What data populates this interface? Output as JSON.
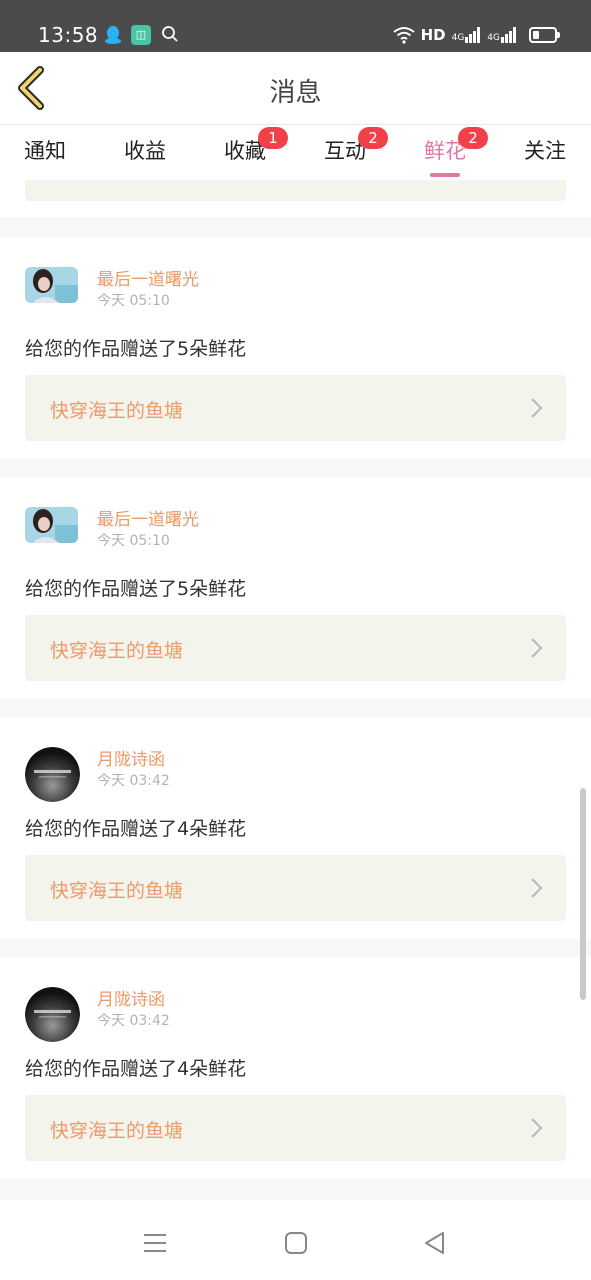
{
  "status_bar": {
    "time": "13:58",
    "icons": [
      "qq-icon",
      "app-icon",
      "search-icon",
      "wifi-icon",
      "hd-icon",
      "signal-4g-icon",
      "signal-4g-icon",
      "battery-icon"
    ],
    "hd": "HD",
    "net1": "4G",
    "net2": "4G"
  },
  "header": {
    "title": "消息"
  },
  "tabs": [
    {
      "label": "通知",
      "badge": "",
      "active": false
    },
    {
      "label": "收益",
      "badge": "",
      "active": false
    },
    {
      "label": "收藏",
      "badge": "1",
      "active": false
    },
    {
      "label": "互动",
      "badge": "2",
      "active": false
    },
    {
      "label": "鲜花",
      "badge": "2",
      "active": true
    },
    {
      "label": "关注",
      "badge": "",
      "active": false
    }
  ],
  "messages": [
    {
      "user": "最后一道曙光",
      "time": "今天 05:10",
      "text": "给您的作品赠送了5朵鲜花",
      "work": "快穿海王的鱼塘",
      "avatar": "portrait-avatar"
    },
    {
      "user": "最后一道曙光",
      "time": "今天 05:10",
      "text": "给您的作品赠送了5朵鲜花",
      "work": "快穿海王的鱼塘",
      "avatar": "portrait-avatar"
    },
    {
      "user": "月陇诗函",
      "time": "今天 03:42",
      "text": "给您的作品赠送了4朵鲜花",
      "work": "快穿海王的鱼塘",
      "avatar": "ink-avatar"
    },
    {
      "user": "月陇诗函",
      "time": "今天 03:42",
      "text": "给您的作品赠送了4朵鲜花",
      "work": "快穿海王的鱼塘",
      "avatar": "ink-avatar"
    }
  ],
  "colors": {
    "accent_pink": "#e575a5",
    "name_orange": "#eb9a6a",
    "badge_red": "#f0404a",
    "status_bar": "#4b4b4b",
    "work_bg": "#f4f4ec"
  }
}
